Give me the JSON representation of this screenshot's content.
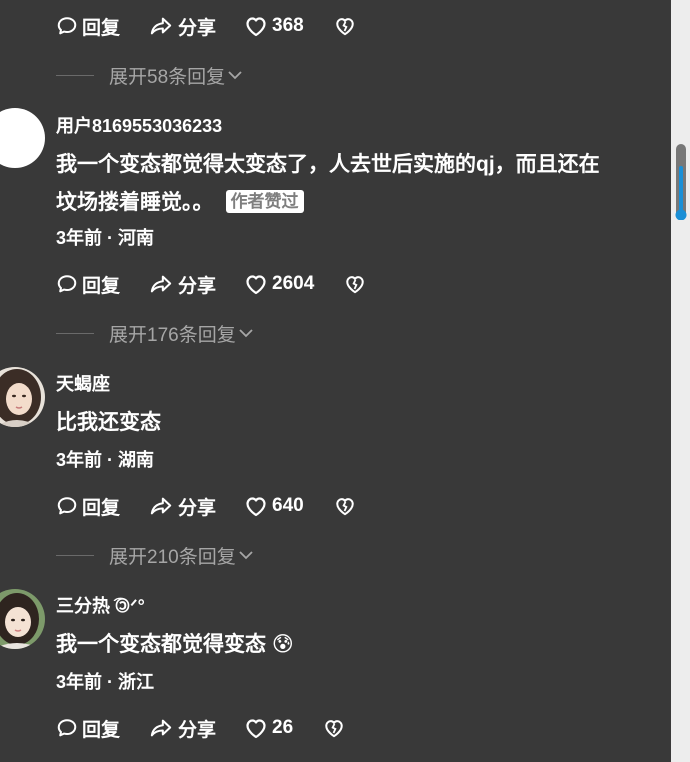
{
  "actions_labels": {
    "reply": "回复",
    "share": "分享"
  },
  "top_actions": {
    "likes": "368"
  },
  "threads": [
    {
      "expand": "展开58条回复",
      "user": "用户8169553036233",
      "text_lines": [
        "我一个变态都觉得太变态了，人去世后实施的qj，而且还在",
        "坟场搂着睡觉。。"
      ],
      "badge": "作者赞过",
      "meta": "3年前 · 河南",
      "likes": "2604"
    },
    {
      "expand": "展开176条回复",
      "user": "天蝎座",
      "text_lines": [
        "比我还变态"
      ],
      "meta": "3年前 · 湖南",
      "likes": "640"
    },
    {
      "expand": "展开210条回复",
      "user": "三分热 ͡🄯ᐟ°",
      "text_lines": [
        "我一个变态都觉得变态 😰"
      ],
      "meta": "3年前 · 浙江",
      "likes": "26"
    }
  ],
  "colors": {
    "background": "#393939",
    "muted_text": "#a6a6a6",
    "scrollbar_accent": "#1a8fd6"
  }
}
